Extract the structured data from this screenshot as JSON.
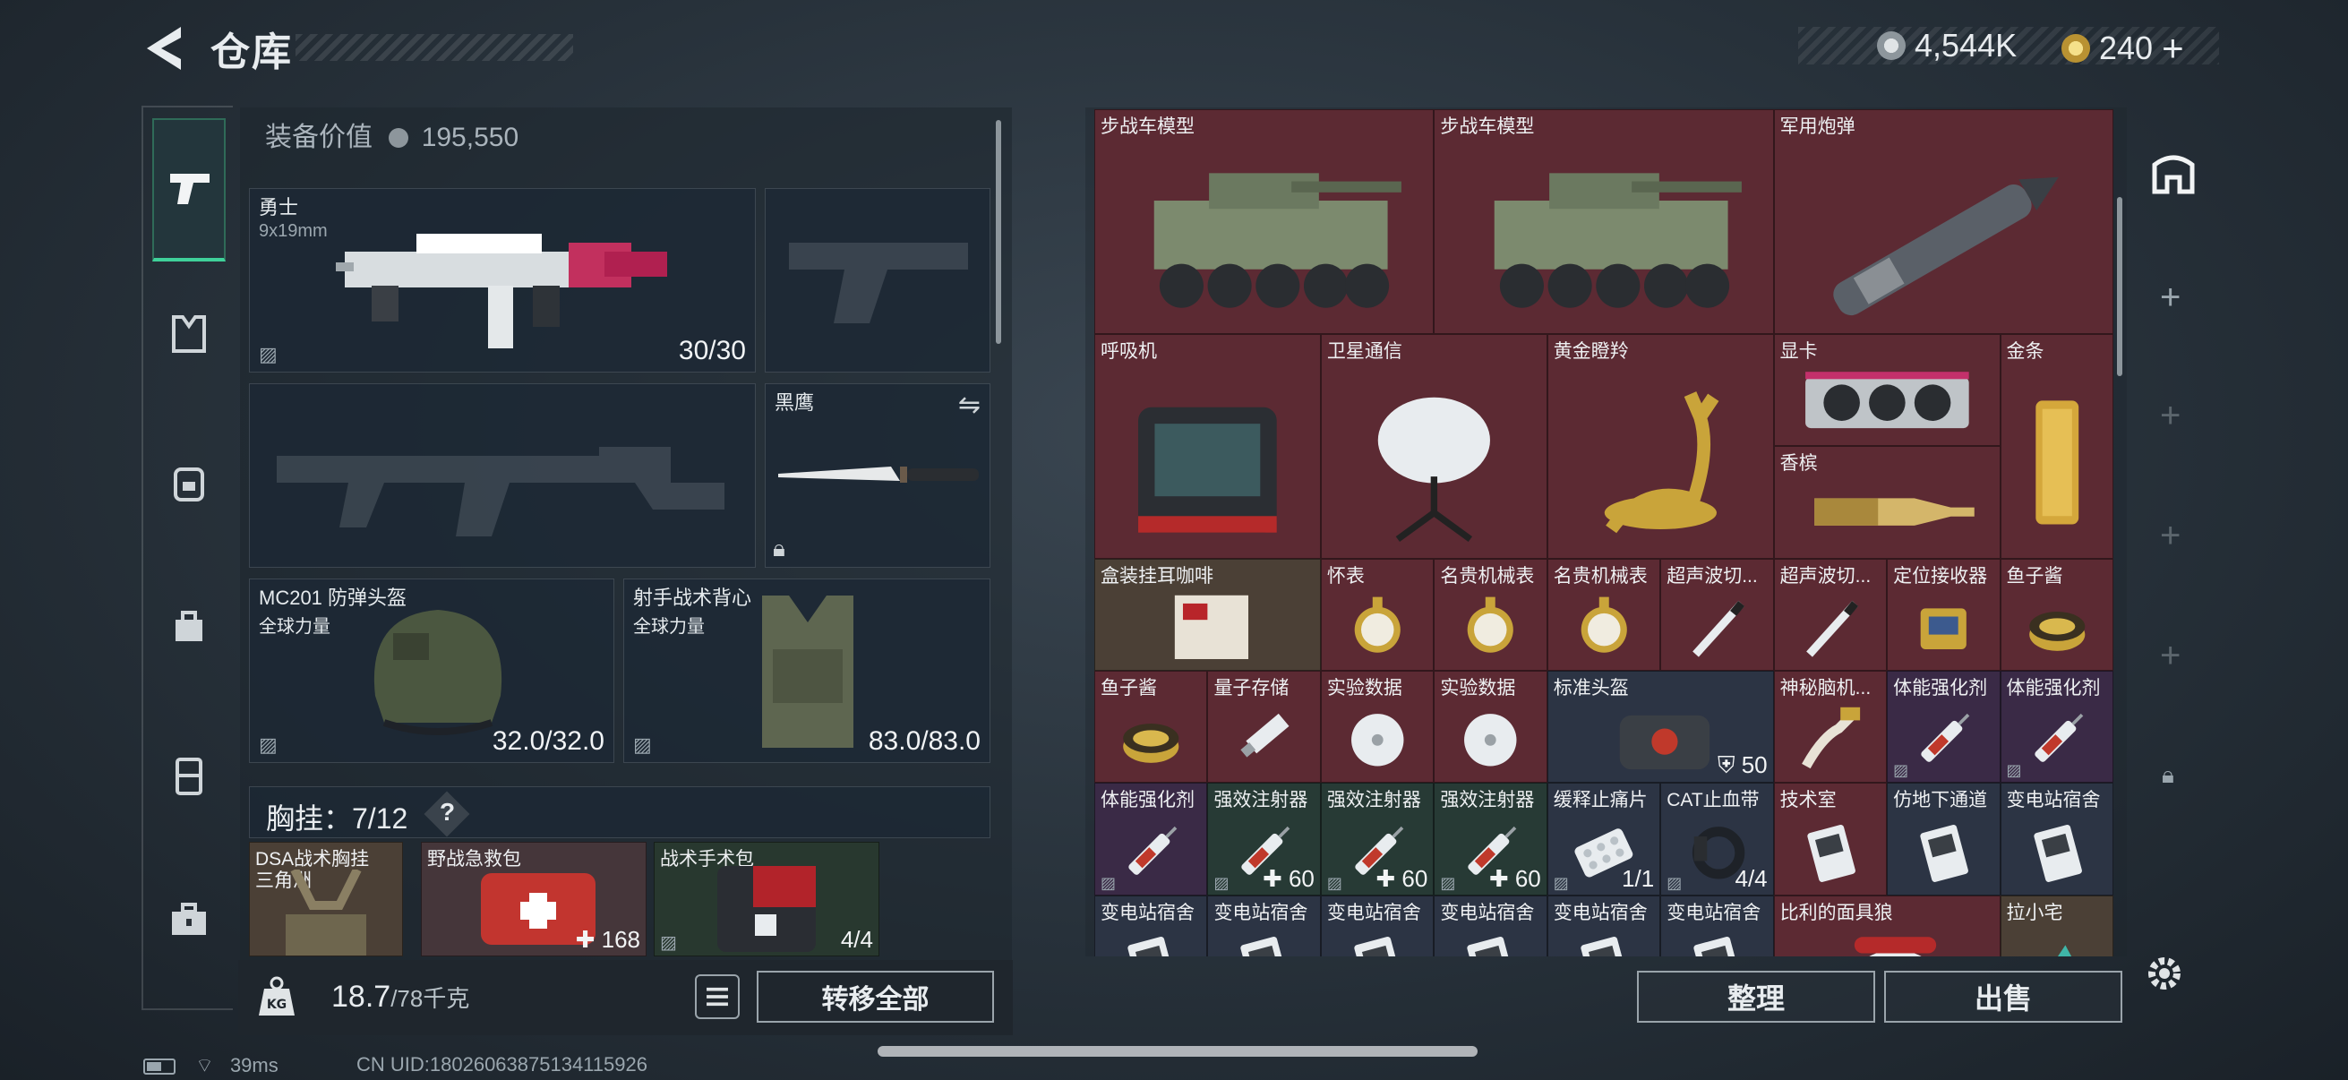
{
  "header": {
    "title": "仓库"
  },
  "currency": {
    "silver": "4,544K",
    "gold": "240",
    "gold_plus": "+"
  },
  "equipment": {
    "value_label": "装备价值",
    "value": "195,550"
  },
  "weapon_primary": {
    "name": "勇士",
    "caliber": "9x19mm",
    "ammo": "30/30"
  },
  "knife": {
    "name": "黑鹰"
  },
  "helmet": {
    "name": "MC201 防弹头盔",
    "faction": "全球力量",
    "durability": "32.0/32.0"
  },
  "armor": {
    "name": "射手战术背心",
    "faction": "全球力量",
    "durability": "83.0/83.0"
  },
  "chest_rig": {
    "label": "胸挂：7/12",
    "help": "?"
  },
  "rig_items": [
    {
      "name": "DSA战术胸挂",
      "sub": "三角洲",
      "value": ""
    },
    {
      "name": "野战急救包",
      "value": "168"
    },
    {
      "name": "战术手术包",
      "value": "4/4"
    }
  ],
  "weight": {
    "current": "18.7",
    "max": "/78千克"
  },
  "buttons": {
    "move_all": "转移全部",
    "sort": "整理",
    "sell": "出售"
  },
  "grid_items": [
    {
      "name": "步战车模型",
      "value": ""
    },
    {
      "name": "步战车模型",
      "value": ""
    },
    {
      "name": "军用炮弹",
      "value": ""
    },
    {
      "name": "呼吸机",
      "value": ""
    },
    {
      "name": "卫星通信",
      "value": ""
    },
    {
      "name": "黄金瞪羚",
      "value": ""
    },
    {
      "name": "显卡",
      "value": ""
    },
    {
      "name": "金条",
      "value": ""
    },
    {
      "name": "香槟",
      "value": ""
    },
    {
      "name": "盒装挂耳咖啡",
      "value": ""
    },
    {
      "name": "怀表",
      "value": ""
    },
    {
      "name": "名贵机械表",
      "value": ""
    },
    {
      "name": "名贵机械表",
      "value": ""
    },
    {
      "name": "超声波切...",
      "value": ""
    },
    {
      "name": "超声波切...",
      "value": ""
    },
    {
      "name": "定位接收器",
      "value": ""
    },
    {
      "name": "鱼子酱",
      "value": ""
    },
    {
      "name": "鱼子酱",
      "value": ""
    },
    {
      "name": "量子存储",
      "value": ""
    },
    {
      "name": "实验数据",
      "value": ""
    },
    {
      "name": "实验数据",
      "value": ""
    },
    {
      "name": "标准头盔",
      "value": "50"
    },
    {
      "name": "神秘脑机...",
      "value": ""
    },
    {
      "name": "体能强化剂",
      "value": ""
    },
    {
      "name": "体能强化剂",
      "value": ""
    },
    {
      "name": "体能强化剂",
      "value": ""
    },
    {
      "name": "强效注射器",
      "value": "60"
    },
    {
      "name": "强效注射器",
      "value": "60"
    },
    {
      "name": "强效注射器",
      "value": "60"
    },
    {
      "name": "缓释止痛片",
      "value": "1/1"
    },
    {
      "name": "CAT止血带",
      "value": "4/4"
    },
    {
      "name": "技术室",
      "value": ""
    },
    {
      "name": "仿地下通道",
      "value": ""
    },
    {
      "name": "变电站宿舍",
      "value": ""
    },
    {
      "name": "变电站宿舍",
      "value": ""
    },
    {
      "name": "变电站宿舍",
      "value": ""
    },
    {
      "name": "变电站宿舍",
      "value": ""
    },
    {
      "name": "变电站宿舍",
      "value": ""
    },
    {
      "name": "变电站宿舍",
      "value": ""
    },
    {
      "name": "变电站宿舍",
      "value": ""
    },
    {
      "name": "比利的面具狼",
      "value": ""
    },
    {
      "name": "拉小宅",
      "value": ""
    }
  ],
  "status": {
    "ping": "39ms",
    "uid": "CN UID:18026063875134115926"
  },
  "colors": {
    "accent": "#3fd19a",
    "rarity_red": "#5c2a33",
    "rarity_gold": "#4b4036",
    "rarity_blue": "#2c3444",
    "rarity_purple": "#3a2a46",
    "rarity_green": "#273a35"
  }
}
